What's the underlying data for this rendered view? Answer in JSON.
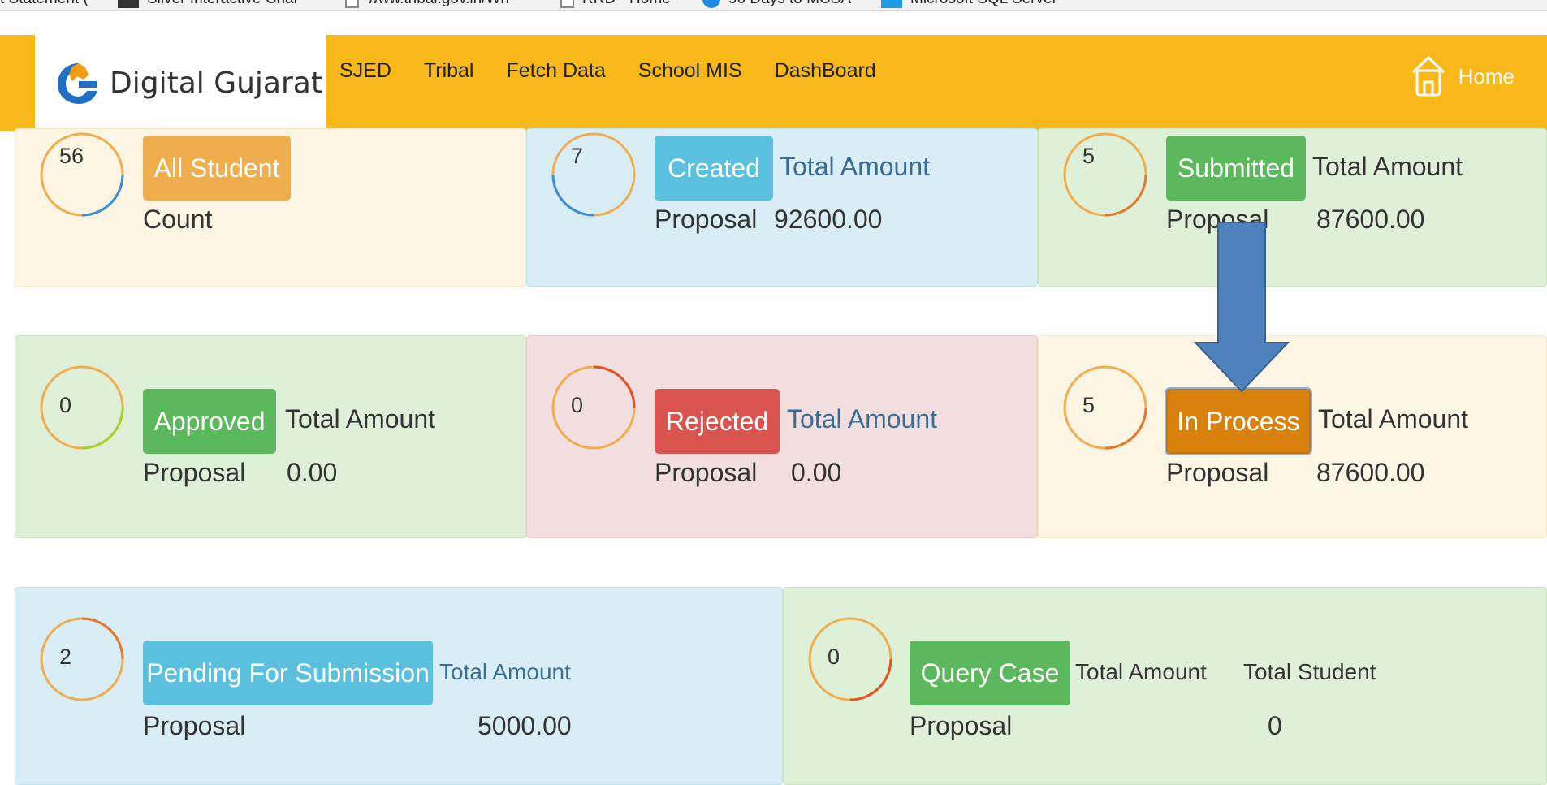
{
  "bookmarks": [
    {
      "label": "t Statement (",
      "icon": ""
    },
    {
      "label": "Silver Interactive Char",
      "icon": "chart-icon"
    },
    {
      "label": "www.tribal.gov.in/Wh",
      "icon": "page-icon"
    },
    {
      "label": "RRD - Home",
      "icon": "page-icon"
    },
    {
      "label": "90 Days to MCSA",
      "icon": "globe-icon"
    },
    {
      "label": "Microsoft SQL Server",
      "icon": "sql-icon"
    }
  ],
  "navbar": {
    "brand": "Digital Gujarat",
    "links": [
      "SJED",
      "Tribal",
      "Fetch Data",
      "School MIS",
      "DashBoard"
    ],
    "home": "Home"
  },
  "cards": {
    "all_student": {
      "count": "56",
      "badge": "All Student",
      "sub": "Count"
    },
    "created": {
      "count": "7",
      "badge": "Created",
      "total_label": "Total Amount",
      "proposal_label": "Proposal",
      "amount": "92600.00"
    },
    "submitted": {
      "count": "5",
      "badge": "Submitted",
      "total_label": "Total Amount",
      "proposal_label": "Proposal",
      "amount": "87600.00"
    },
    "approved": {
      "count": "0",
      "badge": "Approved",
      "total_label": "Total Amount",
      "proposal_label": "Proposal",
      "amount": "0.00"
    },
    "rejected": {
      "count": "0",
      "badge": "Rejected",
      "total_label": "Total Amount",
      "proposal_label": "Proposal",
      "amount": "0.00"
    },
    "in_process": {
      "count": "5",
      "badge": "In Process",
      "total_label": "Total Amount",
      "proposal_label": "Proposal",
      "amount": "87600.00"
    },
    "pending": {
      "count": "2",
      "badge": "Pending For Submission",
      "total_label": "Total Amount",
      "proposal_label": "Proposal",
      "amount": "5000.00"
    },
    "query": {
      "count": "0",
      "badge": "Query Case",
      "total_label": "Total Amount",
      "student_label": "Total Student",
      "proposal_label": "Proposal",
      "students": "0"
    }
  },
  "colors": {
    "navbar": "#f8b81a",
    "badge_orange": "#f0ad4e",
    "badge_blue": "#5bc0de",
    "badge_green": "#5cb85c",
    "badge_red": "#d9534f",
    "badge_in_process": "#d8820d",
    "arrow": "#4f81bd"
  }
}
